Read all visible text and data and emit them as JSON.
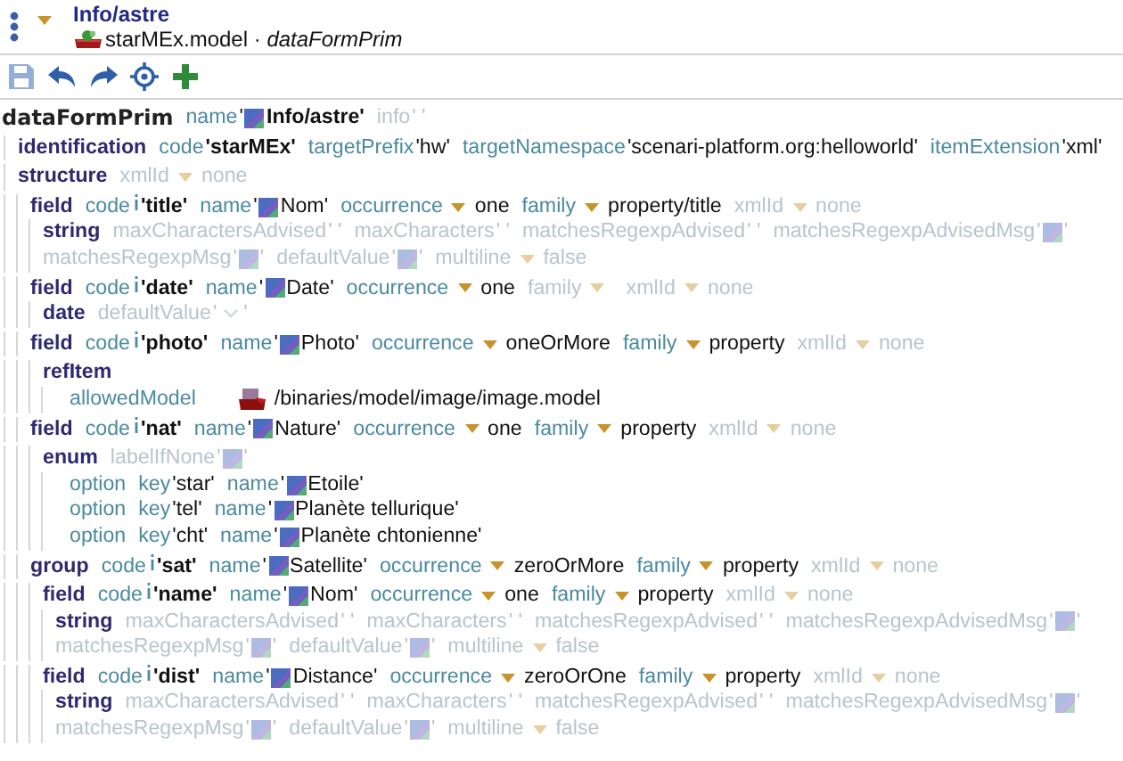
{
  "header": {
    "title": "Info/astre",
    "subtitle": "starMEx.model · *dataFormPrim*"
  },
  "toolbar": [
    {
      "kind": "save",
      "disabled": true
    },
    {
      "kind": "undo",
      "disabled": false
    },
    {
      "kind": "redo",
      "disabled": false
    },
    {
      "kind": "target",
      "disabled": false
    },
    {
      "kind": "add",
      "disabled": false
    }
  ],
  "tree": {
    "tag": "dataFormPrim",
    "kind": "root",
    "attrs": [
      {
        "name": "name",
        "kind": "title",
        "open": "'",
        "value": "Info/astre'",
        "default": false
      },
      {
        "name": "info",
        "kind": "text",
        "value": "' '",
        "default": true
      }
    ],
    "children": [
      {
        "tag": "identification",
        "kind": "element",
        "attrs": [
          {
            "name": "code",
            "kind": "key",
            "value": "'starMEx'",
            "default": false
          },
          {
            "name": "targetPrefix",
            "kind": "text",
            "value": "'hw'",
            "default": false
          },
          {
            "name": "targetNamespace",
            "kind": "text",
            "value": "'scenari-platform.org:helloworld'",
            "default": false
          },
          {
            "name": "itemExtension",
            "kind": "text",
            "value": "'xml'",
            "default": false
          }
        ]
      },
      {
        "tag": "structure",
        "kind": "element",
        "attrs": [
          {
            "name": "xmlId",
            "kind": "select",
            "value": "none",
            "default": true
          }
        ],
        "children": [
          {
            "tag": "field",
            "kind": "element",
            "attrs": [
              {
                "name": "code",
                "kind": "code",
                "value": "'title'",
                "default": false
              },
              {
                "name": "name",
                "kind": "i18n",
                "open": "'",
                "value": "Nom'",
                "default": false
              },
              {
                "name": "occurrence",
                "kind": "select",
                "value": "one",
                "default": false
              },
              {
                "name": "family",
                "kind": "select",
                "value": "property/title",
                "default": false
              },
              {
                "name": "xmlId",
                "kind": "select",
                "value": "none",
                "default": true
              }
            ],
            "children": [
              {
                "tag": "string",
                "kind": "element",
                "attrs": [
                  {
                    "name": "maxCharactersAdvised",
                    "kind": "text",
                    "value": "' '",
                    "default": true
                  },
                  {
                    "name": "maxCharacters",
                    "kind": "text",
                    "value": "' '",
                    "default": true
                  },
                  {
                    "name": "matchesRegexpAdvised",
                    "kind": "text",
                    "value": "' '",
                    "default": true
                  },
                  {
                    "name": "matchesRegexpAdvisedMsg",
                    "kind": "i18n",
                    "open": "'",
                    "value": "'",
                    "default": true
                  },
                  {
                    "name": "matchesRegexpMsg",
                    "kind": "i18n",
                    "open": "'",
                    "value": "'",
                    "default": true
                  },
                  {
                    "name": "defaultValue",
                    "kind": "i18n",
                    "open": "'",
                    "value": "'",
                    "default": true
                  },
                  {
                    "name": "multiline",
                    "kind": "select",
                    "value": "false",
                    "default": true
                  }
                ]
              }
            ]
          },
          {
            "tag": "field",
            "kind": "element",
            "attrs": [
              {
                "name": "code",
                "kind": "code",
                "value": "'date'",
                "default": false
              },
              {
                "name": "name",
                "kind": "i18n",
                "open": "'",
                "value": "Date'",
                "default": false
              },
              {
                "name": "occurrence",
                "kind": "select",
                "value": "one",
                "default": false
              },
              {
                "name": "family",
                "kind": "select",
                "default": true
              },
              {
                "name": "xmlId",
                "kind": "select",
                "value": "none",
                "default": true
              }
            ],
            "children": [
              {
                "tag": "date",
                "kind": "element",
                "attrs": [
                  {
                    "name": "defaultValue",
                    "kind": "date",
                    "open": "'",
                    "value": "'",
                    "default": true
                  }
                ]
              }
            ]
          },
          {
            "tag": "field",
            "kind": "element",
            "attrs": [
              {
                "name": "code",
                "kind": "code",
                "value": "'photo'",
                "default": false
              },
              {
                "name": "name",
                "kind": "i18n",
                "open": "'",
                "value": "Photo'",
                "default": false
              },
              {
                "name": "occurrence",
                "kind": "select",
                "value": "oneOrMore",
                "default": false
              },
              {
                "name": "family",
                "kind": "select",
                "value": "property",
                "default": false
              },
              {
                "name": "xmlId",
                "kind": "select",
                "value": "none",
                "default": true
              }
            ],
            "children": [
              {
                "tag": "refItem",
                "kind": "element",
                "children": [
                  {
                    "tag": "allowedModel",
                    "kind": "plain",
                    "attrs": [
                      {
                        "kind": "model",
                        "value": "/binaries/model/image/image.model",
                        "default": false
                      }
                    ]
                  }
                ]
              }
            ]
          },
          {
            "tag": "field",
            "kind": "element",
            "attrs": [
              {
                "name": "code",
                "kind": "code",
                "value": "'nat'",
                "default": false
              },
              {
                "name": "name",
                "kind": "i18n",
                "open": "'",
                "value": "Nature'",
                "default": false
              },
              {
                "name": "occurrence",
                "kind": "select",
                "value": "one",
                "default": false
              },
              {
                "name": "family",
                "kind": "select",
                "value": "property",
                "default": false
              },
              {
                "name": "xmlId",
                "kind": "select",
                "value": "none",
                "default": true
              }
            ],
            "children": [
              {
                "tag": "enum",
                "kind": "element",
                "attrs": [
                  {
                    "name": "labelIfNone",
                    "kind": "i18n",
                    "open": "'",
                    "value": "'",
                    "default": true
                  }
                ],
                "children": [
                  {
                    "tag": "option",
                    "kind": "plain",
                    "attrs": [
                      {
                        "name": "key",
                        "kind": "text",
                        "value": "'star'",
                        "default": false
                      },
                      {
                        "name": "name",
                        "kind": "i18n",
                        "open": "'",
                        "value": "Etoile'",
                        "default": false
                      }
                    ]
                  },
                  {
                    "tag": "option",
                    "kind": "plain",
                    "attrs": [
                      {
                        "name": "key",
                        "kind": "text",
                        "value": "'tel'",
                        "default": false
                      },
                      {
                        "name": "name",
                        "kind": "i18n",
                        "open": "'",
                        "value": "Planète tellurique'",
                        "default": false
                      }
                    ]
                  },
                  {
                    "tag": "option",
                    "kind": "plain",
                    "attrs": [
                      {
                        "name": "key",
                        "kind": "text",
                        "value": "'cht'",
                        "default": false
                      },
                      {
                        "name": "name",
                        "kind": "i18n",
                        "open": "'",
                        "value": "Planète chtonienne'",
                        "default": false
                      }
                    ]
                  }
                ]
              }
            ]
          },
          {
            "tag": "group",
            "kind": "element",
            "attrs": [
              {
                "name": "code",
                "kind": "code",
                "value": "'sat'",
                "default": false
              },
              {
                "name": "name",
                "kind": "i18n",
                "open": "'",
                "value": "Satellite'",
                "default": false
              },
              {
                "name": "occurrence",
                "kind": "select",
                "value": "zeroOrMore",
                "default": false
              },
              {
                "name": "family",
                "kind": "select",
                "value": "property",
                "default": false
              },
              {
                "name": "xmlId",
                "kind": "select",
                "value": "none",
                "default": true
              }
            ],
            "children": [
              {
                "tag": "field",
                "kind": "element",
                "attrs": [
                  {
                    "name": "code",
                    "kind": "code",
                    "value": "'name'",
                    "default": false
                  },
                  {
                    "name": "name",
                    "kind": "i18n",
                    "open": "'",
                    "value": "Nom'",
                    "default": false
                  },
                  {
                    "name": "occurrence",
                    "kind": "select",
                    "value": "one",
                    "default": false
                  },
                  {
                    "name": "family",
                    "kind": "select",
                    "value": "property",
                    "default": false
                  },
                  {
                    "name": "xmlId",
                    "kind": "select",
                    "value": "none",
                    "default": true
                  }
                ],
                "children": [
                  {
                    "tag": "string",
                    "kind": "element",
                    "attrs": [
                      {
                        "name": "maxCharactersAdvised",
                        "kind": "text",
                        "value": "' '",
                        "default": true
                      },
                      {
                        "name": "maxCharacters",
                        "kind": "text",
                        "value": "' '",
                        "default": true
                      },
                      {
                        "name": "matchesRegexpAdvised",
                        "kind": "text",
                        "value": "' '",
                        "default": true
                      },
                      {
                        "name": "matchesRegexpAdvisedMsg",
                        "kind": "i18n",
                        "open": "'",
                        "value": "'",
                        "default": true
                      },
                      {
                        "name": "matchesRegexpMsg",
                        "kind": "i18n",
                        "open": "'",
                        "value": "'",
                        "default": true
                      },
                      {
                        "name": "defaultValue",
                        "kind": "i18n",
                        "open": "'",
                        "value": "'",
                        "default": true
                      },
                      {
                        "name": "multiline",
                        "kind": "select",
                        "value": "false",
                        "default": true
                      }
                    ]
                  }
                ]
              },
              {
                "tag": "field",
                "kind": "element",
                "attrs": [
                  {
                    "name": "code",
                    "kind": "code",
                    "value": "'dist'",
                    "default": false
                  },
                  {
                    "name": "name",
                    "kind": "i18n",
                    "open": "'",
                    "value": "Distance'",
                    "default": false
                  },
                  {
                    "name": "occurrence",
                    "kind": "select",
                    "value": "zeroOrOne",
                    "default": false
                  },
                  {
                    "name": "family",
                    "kind": "select",
                    "value": "property",
                    "default": false
                  },
                  {
                    "name": "xmlId",
                    "kind": "select",
                    "value": "none",
                    "default": true
                  }
                ],
                "children": [
                  {
                    "tag": "string",
                    "kind": "element",
                    "attrs": [
                      {
                        "name": "maxCharactersAdvised",
                        "kind": "text",
                        "value": "' '",
                        "default": true
                      },
                      {
                        "name": "maxCharacters",
                        "kind": "text",
                        "value": "' '",
                        "default": true
                      },
                      {
                        "name": "matchesRegexpAdvised",
                        "kind": "text",
                        "value": "' '",
                        "default": true
                      },
                      {
                        "name": "matchesRegexpAdvisedMsg",
                        "kind": "i18n",
                        "open": "'",
                        "value": "'",
                        "default": true
                      },
                      {
                        "name": "matchesRegexpMsg",
                        "kind": "i18n",
                        "open": "'",
                        "value": "'",
                        "default": true
                      },
                      {
                        "name": "defaultValue",
                        "kind": "i18n",
                        "open": "'",
                        "value": "'",
                        "default": true
                      },
                      {
                        "name": "multiline",
                        "kind": "select",
                        "value": "false",
                        "default": true
                      }
                    ]
                  }
                ]
              }
            ]
          }
        ]
      }
    ]
  }
}
